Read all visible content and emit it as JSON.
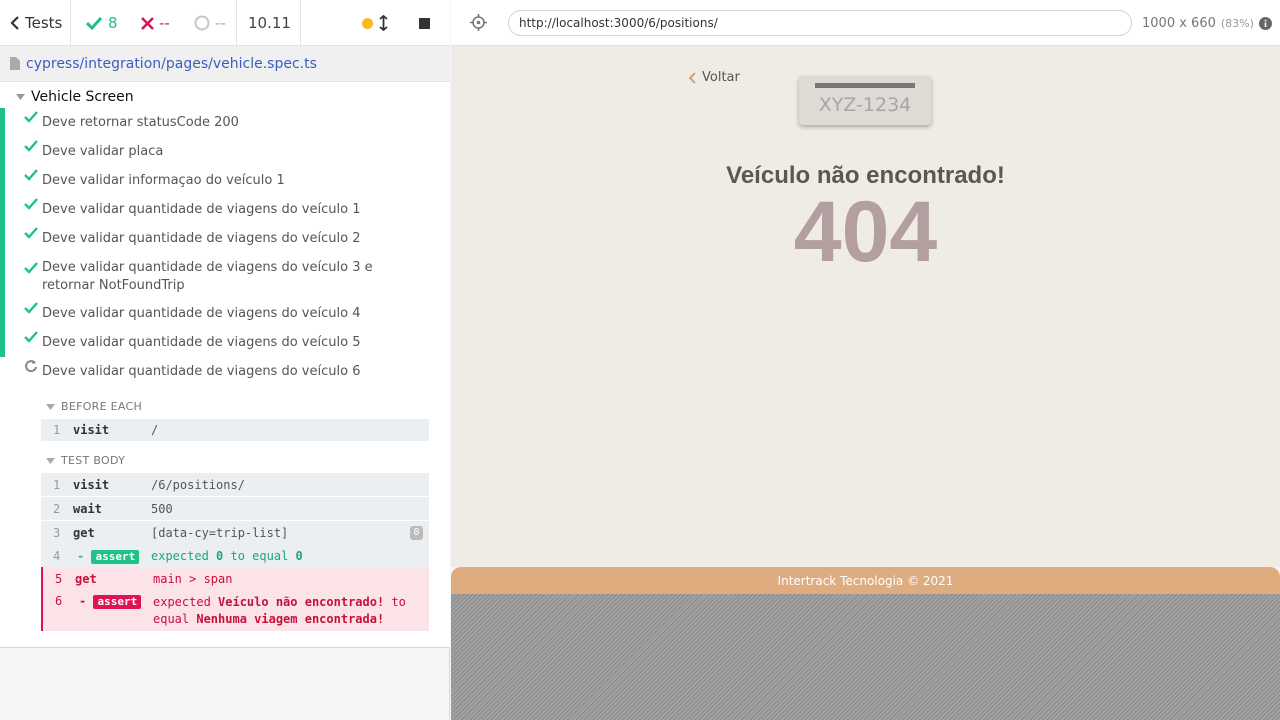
{
  "reporter": {
    "tests_label": "Tests",
    "passed": "8",
    "failed": "--",
    "pending": "--",
    "duration": "10.11",
    "spec_path": "cypress/integration/pages/vehicle.spec.ts",
    "suite_title": "Vehicle Screen",
    "tests": [
      "Deve retornar statusCode 200",
      "Deve validar placa",
      "Deve validar informaçao do veículo 1",
      "Deve validar quantidade de viagens do veículo 1",
      "Deve validar quantidade de viagens do veículo 2",
      "Deve validar quantidade de viagens do veículo 3 e retornar NotFoundTrip",
      "Deve validar quantidade de viagens do veículo 4",
      "Deve validar quantidade de viagens do veículo 5",
      "Deve validar quantidade de viagens do veículo 6"
    ],
    "before_each_title": "BEFORE EACH",
    "test_body_title": "TEST BODY",
    "before_each": [
      {
        "num": "1",
        "name": "visit",
        "msg": "/"
      }
    ],
    "body": [
      {
        "num": "1",
        "name": "visit",
        "msg": "/6/positions/"
      },
      {
        "num": "2",
        "name": "wait",
        "msg": "500"
      },
      {
        "num": "3",
        "name": "get",
        "msg": "[data-cy=trip-list]",
        "count": "0"
      },
      {
        "num": "4",
        "name": "-",
        "badge": "assert",
        "pre": "expected",
        "v1": "0",
        "mid": "to equal",
        "v2": "0"
      },
      {
        "num": "5",
        "name": "get",
        "msg": "main > span"
      },
      {
        "num": "6",
        "name": "-",
        "badge": "assert",
        "pre": "expected",
        "v1": "Veículo não encontrado!",
        "mid": "to",
        "mid2": "equal",
        "v2": "Nenhuma viagem encontrada!"
      }
    ]
  },
  "aut": {
    "url": "http://localhost:3000/6/positions/",
    "viewport": "1000 x 660",
    "scale": "(83%)",
    "back_label": "Voltar",
    "plate": "XYZ-1234",
    "message": "Veículo não encontrado!",
    "code": "404",
    "footer": "Intertrack Tecnologia © 2021"
  },
  "colors": {
    "pass": "#1fc286",
    "fail": "#e01256",
    "pending": "#ffb61e",
    "link": "#3a5ec0",
    "app_bg": "#efece6",
    "footer_bg": "#dfac7f",
    "code_color": "#b39f9f"
  }
}
